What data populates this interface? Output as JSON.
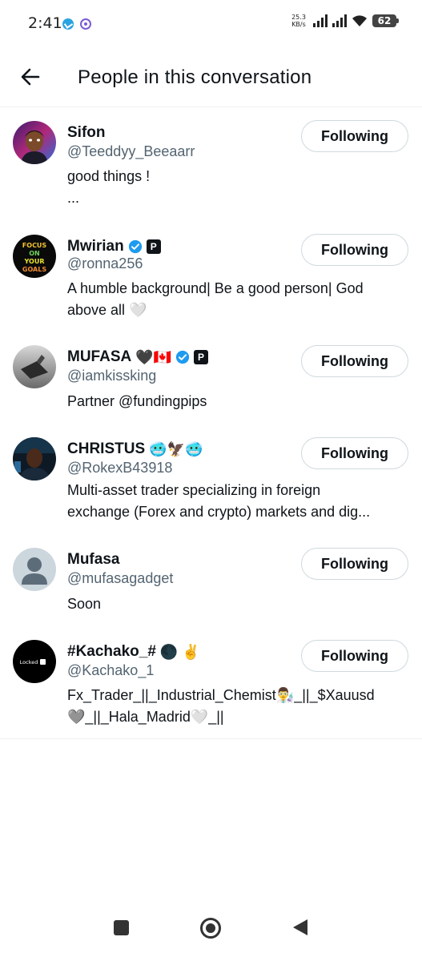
{
  "status_bar": {
    "time": "2:41",
    "net_speed_value": "25.3",
    "net_speed_unit": "KB/s",
    "battery": "62"
  },
  "header": {
    "title": "People in this conversation",
    "back_icon": "arrow-left-icon"
  },
  "users": [
    {
      "name": "Sifon",
      "handle": "@Teeddyy_Beeaarr",
      "bio_lines": [
        "good things !",
        "..."
      ],
      "follow_label": "Following",
      "verified": false,
      "pro": false,
      "emojis": ""
    },
    {
      "name": "Mwirian",
      "handle": "@ronna256",
      "bio_lines": [
        "A humble background| Be a good person| God",
        "above all 🤍"
      ],
      "follow_label": "Following",
      "verified": true,
      "pro": true,
      "emojis": ""
    },
    {
      "name": "MUFASA",
      "name_emojis": "🖤🇨🇦",
      "handle": "@iamkissking",
      "bio_lines": [
        "Partner @fundingpips"
      ],
      "follow_label": "Following",
      "verified": true,
      "pro": true
    },
    {
      "name": "CHRISTUS",
      "name_emojis": "🥶🦅🥶",
      "handle": "@RokexB43918",
      "bio_lines": [
        "Multi-asset trader specializing in foreign",
        "exchange (Forex and crypto) markets and dig..."
      ],
      "follow_label": "Following",
      "verified": false,
      "pro": false
    },
    {
      "name": "Mufasa",
      "name_emojis": "",
      "handle": "@mufasagadget",
      "bio_lines": [
        "Soon"
      ],
      "follow_label": "Following",
      "verified": false,
      "pro": false
    },
    {
      "name": "#Kachako_#",
      "name_emojis": "🌑 ✌️",
      "handle": "@Kachako_1",
      "bio_lines": [
        "Fx_Trader_||_Industrial_Chemist👨‍🔬_||_$Xauusd",
        "🩶_||_Hala_Madrid🤍_||"
      ],
      "follow_label": "Following",
      "verified": false,
      "pro": false,
      "avatar_text": "Locked in"
    }
  ],
  "colors": {
    "verified": "#1d9bf0",
    "handle": "#536471",
    "text": "#0f1419",
    "border": "#cfd9de"
  }
}
